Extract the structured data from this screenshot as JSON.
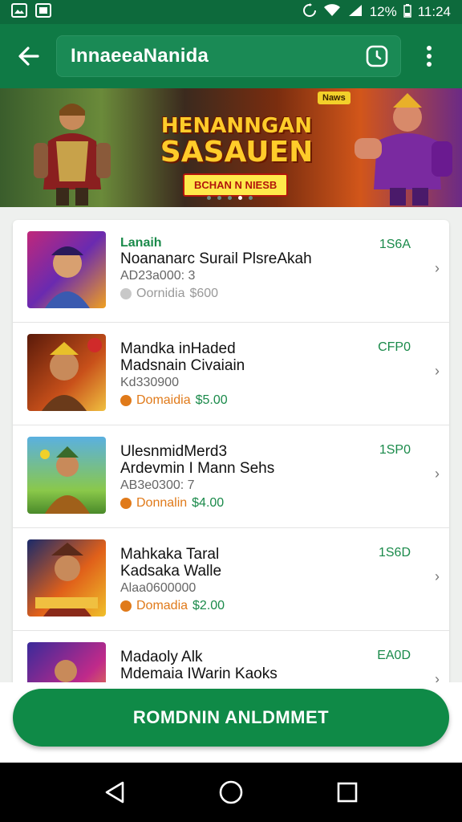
{
  "status_bar": {
    "battery_text": "12%",
    "time": "11:24"
  },
  "app_bar": {
    "title": "InnaeeaNanida"
  },
  "banner": {
    "title_line1": "HENANNGAN",
    "title_line2": "SASAUEN",
    "cta": "BCHAN N NIESB",
    "badge": "",
    "sticker": "Naws"
  },
  "list": {
    "items": [
      {
        "tag": "Lanaih",
        "title": "Noananarc Surail PlsreAkah",
        "subtitle": "AD23a000: 3",
        "meta_label": "Oornidia",
        "meta_price": "$600",
        "right": "1S6A"
      },
      {
        "tag": "",
        "title": "Mandka inHaded\nMadsnain Civaiain",
        "subtitle": "Kd330900",
        "meta_label": "Domaidia",
        "meta_price": "$5.00",
        "right": "CFP0"
      },
      {
        "tag": "",
        "title": "UlesnmidMerd3\nArdevmin I Mann Sehs",
        "subtitle": "AB3e0300: 7",
        "meta_label": "Donnalin",
        "meta_price": "$4.00",
        "right": "1SP0"
      },
      {
        "tag": "",
        "title": "Mahkaka Taral\nKadsaka Walle",
        "subtitle": "Alaa0600000",
        "meta_label": "Domadia",
        "meta_price": "$2.00",
        "right": "1S6D"
      },
      {
        "tag": "",
        "title": "Madaoly Alk\nMdemaia IWarin Kaoks",
        "subtitle": "",
        "meta_label": "",
        "meta_price": "",
        "right": "EA0D"
      }
    ]
  },
  "cta_button": {
    "label": "ROMDNIN ANLDMMET"
  },
  "colors": {
    "primary": "#0f7a45",
    "accent_green": "#1a8a4a",
    "orange": "#e07a1a"
  }
}
